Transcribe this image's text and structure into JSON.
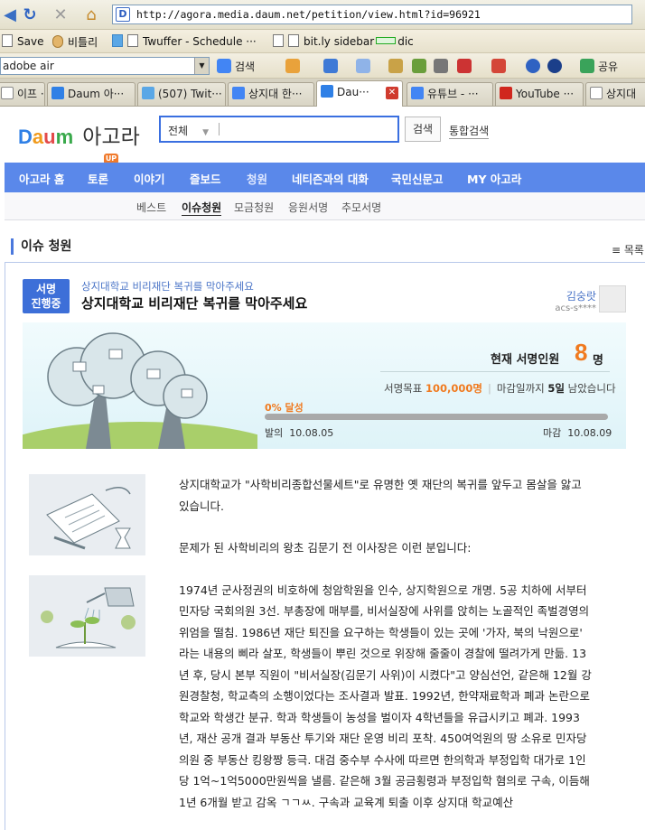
{
  "browser": {
    "url": "http://agora.media.daum.net/petition/view.html?id=96921",
    "bookmarks": [
      "Save",
      "비틀리",
      "Twuffer - Schedule ···",
      "bit.ly sidebar",
      "dic"
    ],
    "search_value": "adobe air",
    "search_button": "검색",
    "share_button": "공유",
    "tabs": [
      {
        "label": "이프 ···",
        "icon": "page-icon"
      },
      {
        "label": "Daum 아···",
        "icon": "daum-icon"
      },
      {
        "label": "(507) Twit···",
        "icon": "twitter-icon"
      },
      {
        "label": "상지대 한···",
        "icon": "google-icon"
      },
      {
        "label": "Dau···",
        "icon": "daum-icon",
        "active": true
      },
      {
        "label": "유튜브 - ···",
        "icon": "google-icon"
      },
      {
        "label": "YouTube ···",
        "icon": "youtube-icon"
      },
      {
        "label": "상지대",
        "icon": "page-icon"
      }
    ]
  },
  "header": {
    "logo_daum": "Daum",
    "logo_agora": "아고라",
    "search_category": "전체",
    "search_button": "검색",
    "unified_search": "통합검색"
  },
  "menu": {
    "items": [
      "아고라 홈",
      "토론",
      "이야기",
      "즐보드",
      "청원",
      "네티즌과의 대화",
      "국민신문고",
      "MY 아고라"
    ],
    "badge": "UP",
    "current": "청원"
  },
  "submenu": {
    "items": [
      "베스트",
      "이슈청원",
      "모금청원",
      "응원서명",
      "추모서명"
    ],
    "current": "이슈청원"
  },
  "section": {
    "title": "이슈 청원",
    "list_link": "목록"
  },
  "petition": {
    "status_line1": "서명",
    "status_line2": "진행중",
    "category": "상지대학교 비리재단 복귀를 막아주세요",
    "title": "상지대학교 비리재단 복귀를 막아주세요",
    "author_name": "김숭랏",
    "author_id": "acs-s****",
    "signature_label": "현재 서명인원",
    "signature_count": "8",
    "signature_unit": "명",
    "goal_label": "서명목표",
    "goal_value": "100,000명",
    "deadline_prefix": "마감일까지",
    "deadline_days": "5일",
    "deadline_suffix": "남았습니다",
    "progress_label": "0% 달성",
    "progress_fraction": 0,
    "start_label": "발의",
    "start_date": "10.08.05",
    "end_label": "마감",
    "end_date": "10.08.09",
    "colors": {
      "accent": "#3d6fd8",
      "highlight": "#f07a1f"
    }
  },
  "body": {
    "para1": "상지대학교가 \"사학비리종합선물세트\"로 유명한 옛 재단의 복귀를 앞두고 몸살을 앓고 있습니다.",
    "para2": "문제가 된 사학비리의 왕초 김문기 전 이사장은 이런 분입니다:",
    "para3": "1974년 군사정권의 비호하에 청암학원을 인수, 상지학원으로 개명. 5공 치하에 서부터 민자당 국회의원 3선. 부총장에 매부를, 비서실장에 사위를 앉히는 노골적인 족벌경영의 위엄을 떨침. 1986년 재단 퇴진을 요구하는 학생들이 있는 곳에 '가자, 북의 낙원으로' 라는 내용의 삐라 살포, 학생들이 뿌린 것으로 위장해 줄줄이 경찰에 떨려가게 만듦. 13년 후, 당시 본부 직원이 \"비서실장(김문기 사위)이 시켰다\"고 양심선언, 같은해 12월 강원경찰청, 학교측의 소행이었다는 조사결과 발표. 1992년, 한약재료학과 폐과 논란으로 학교와 학생간 분규. 학과 학생들이 농성을 벌이자 4학년들을 유급시키고 폐과. 1993년, 재산 공개 결과 부동산 투기와 재단 운영 비리 포착. 450여억원의 땅 소유로 민자당 의원 중 부동산 킹왕짱 등극. 대검 중수부 수사에 따르면 한의학과 부정입학 대가로 1인당 1억~1억5000만원씩을 낼름. 같은해 3월 공금횡령과 부정입학 혐의로 구속, 이듬해 1년 6개월 받고 감옥 ㄱㄱㅆ. 구속과 교육계 퇴출 이후 상지대 학교예산"
  }
}
